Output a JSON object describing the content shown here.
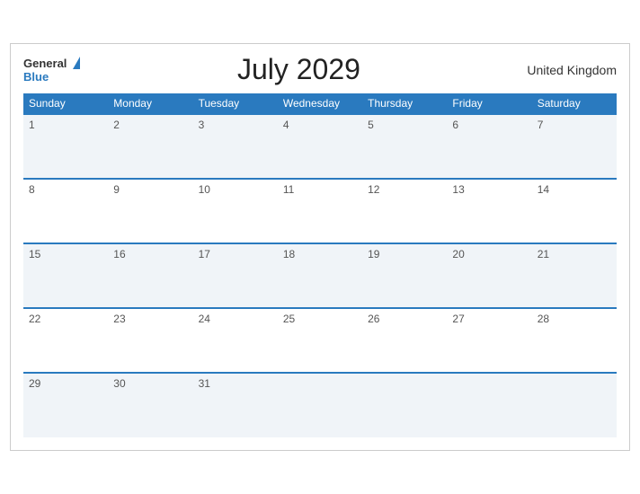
{
  "header": {
    "logo_general": "General",
    "logo_blue": "Blue",
    "title": "July 2029",
    "region": "United Kingdom"
  },
  "weekdays": [
    "Sunday",
    "Monday",
    "Tuesday",
    "Wednesday",
    "Thursday",
    "Friday",
    "Saturday"
  ],
  "weeks": [
    [
      1,
      2,
      3,
      4,
      5,
      6,
      7
    ],
    [
      8,
      9,
      10,
      11,
      12,
      13,
      14
    ],
    [
      15,
      16,
      17,
      18,
      19,
      20,
      21
    ],
    [
      22,
      23,
      24,
      25,
      26,
      27,
      28
    ],
    [
      29,
      30,
      31,
      null,
      null,
      null,
      null
    ]
  ]
}
